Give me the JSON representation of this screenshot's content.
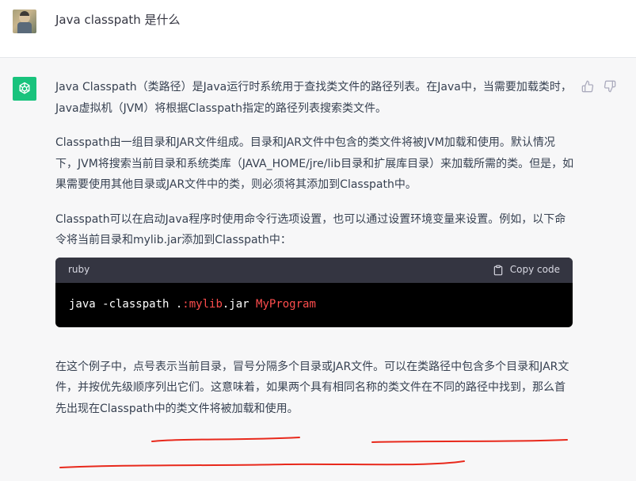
{
  "user": {
    "question": "Java classpath 是什么"
  },
  "assistant": {
    "p1": "Java Classpath（类路径）是Java运行时系统用于查找类文件的路径列表。在Java中，当需要加载类时，Java虚拟机（JVM）将根据Classpath指定的路径列表搜索类文件。",
    "p2": "Classpath由一组目录和JAR文件组成。目录和JAR文件中包含的类文件将被JVM加载和使用。默认情况下，JVM将搜索当前目录和系统类库（JAVA_HOME/jre/lib目录和扩展库目录）来加载所需的类。但是，如果需要使用其他目录或JAR文件中的类，则必须将其添加到Classpath中。",
    "p3": "Classpath可以在启动Java程序时使用命令行选项设置，也可以通过设置环境变量来设置。例如，以下命令将当前目录和mylib.jar添加到Classpath中：",
    "code": {
      "language": "ruby",
      "copy_label": "Copy code",
      "tokens": [
        {
          "text": "java -classpath ",
          "color": "#ffffff"
        },
        {
          "text": ".",
          "color": "#f2f2f2"
        },
        {
          "text": ":mylib",
          "color": "#ff4d4d"
        },
        {
          "text": ".jar ",
          "color": "#ffffff"
        },
        {
          "text": "MyProgram",
          "color": "#ff4d4d"
        }
      ]
    },
    "p4_a": "在这个例子中，点号表示当前目录，冒号分隔多个目录或JAR文件。可以在类路径中包含多个目录和JAR文件，",
    "p4_b": "并按优先级顺序列出它们",
    "p4_c": "。这意味着，",
    "p4_d": "如果两个具有相同名称的类文件在不同的路径中找到，那么首先出现在Classpath中的类文件将被加载和使用",
    "p4_e": "。"
  },
  "colors": {
    "accent": "#19c37d",
    "annotation": "#e8291c"
  },
  "icons": [
    "thumbs-up-icon",
    "thumbs-down-icon",
    "clipboard-icon",
    "openai-logo-icon"
  ]
}
